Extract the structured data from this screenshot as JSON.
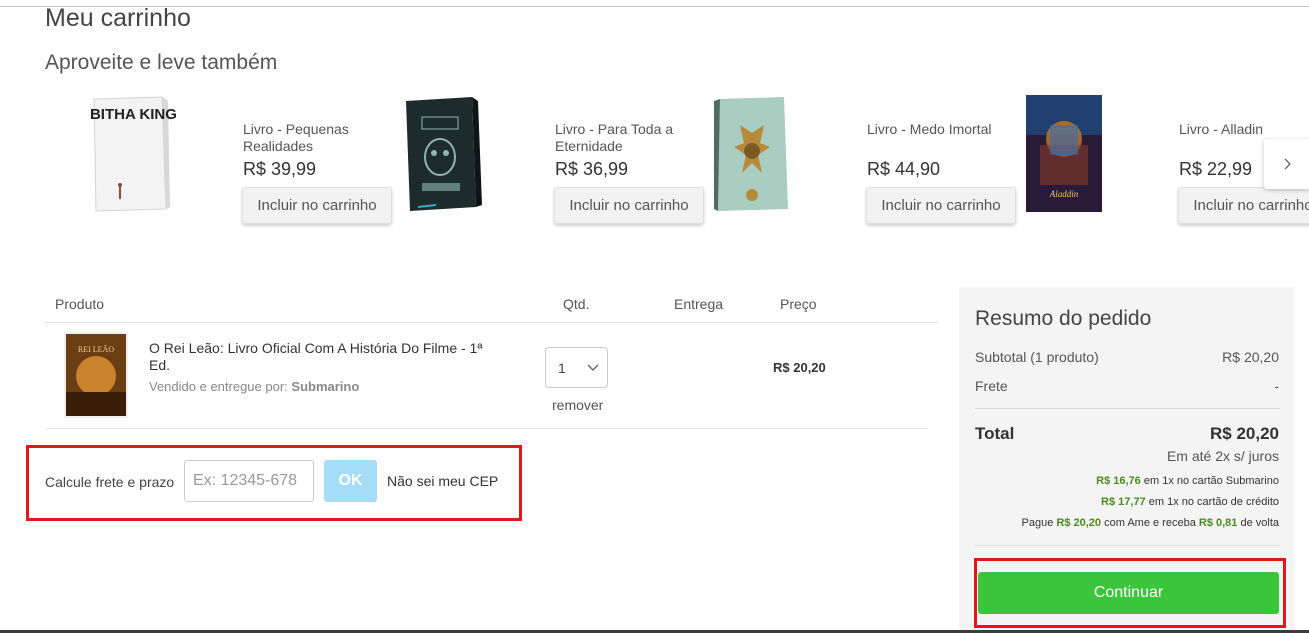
{
  "page": {
    "title": "Meu carrinho",
    "recommendations_title": "Aproveite e leve também"
  },
  "recommendations": [
    {
      "name": "Livro - Pequenas Realidades",
      "price": "R$ 39,99",
      "button": "Incluir no carrinho",
      "cover_text": "TABITHA KING"
    },
    {
      "name": "Livro - Para Toda a Eternidade",
      "price": "R$ 36,99",
      "button": "Incluir no carrinho",
      "cover_text": ""
    },
    {
      "name": "Livro - Medo Imortal",
      "price": "R$ 44,90",
      "button": "Incluir no carrinho",
      "cover_text": ""
    },
    {
      "name": "Livro - Alladin",
      "price": "R$ 22,99",
      "button": "Incluir no carrinho",
      "cover_text": "Aladdin"
    }
  ],
  "cart": {
    "headers": {
      "product": "Produto",
      "qty": "Qtd.",
      "delivery": "Entrega",
      "price": "Preço"
    },
    "items": [
      {
        "name": "O Rei Leão: Livro Oficial Com A História Do Filme - 1ª Ed.",
        "seller_label": "Vendido e entregue por:",
        "seller": "Submarino",
        "qty": "1",
        "remove": "remover",
        "price": "R$ 20,20",
        "cover_text": "REI LEÃO"
      }
    ]
  },
  "shipping": {
    "label": "Calcule frete e prazo",
    "placeholder": "Ex: 12345-678",
    "ok": "OK",
    "unknown_cep": "Não sei meu CEP"
  },
  "summary": {
    "title": "Resumo do pedido",
    "subtotal_label": "Subtotal (1 produto)",
    "subtotal_value": "R$ 20,20",
    "freight_label": "Frete",
    "freight_value": "-",
    "total_label": "Total",
    "total_value": "R$ 20,20",
    "installments": "Em até 2x s/ juros",
    "payment_1_amount": "R$ 16,76",
    "payment_1_text": "em 1x no cartão Submarino",
    "payment_2_amount": "R$ 17,77",
    "payment_2_text": "em 1x no cartão de crédito",
    "payment_3_prefix": "Pague",
    "payment_3_amount": "R$ 20,20",
    "payment_3_mid": "com Ame e receba",
    "payment_3_cashback": "R$ 0,81",
    "payment_3_suffix": "de volta",
    "continue": "Continuar"
  },
  "colors": {
    "accent_green": "#3bc53b",
    "highlight_red": "#e2161b",
    "ok_button": "#a6dcf7",
    "price_green": "#4a8a1f"
  },
  "icons": [
    "chevron-right-icon",
    "chevron-down-icon"
  ]
}
